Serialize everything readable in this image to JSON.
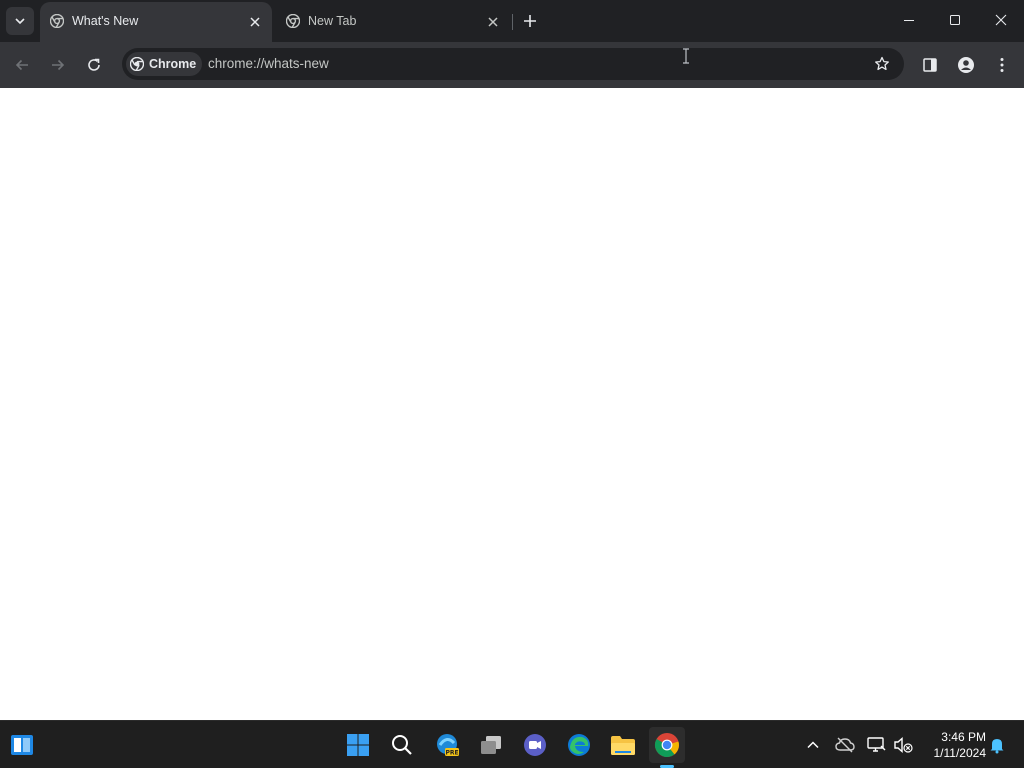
{
  "browser": {
    "tabs": [
      {
        "title": "What's New",
        "active": true
      },
      {
        "title": "New Tab",
        "active": false
      }
    ],
    "toolbar": {
      "chip_label": "Chrome",
      "url": "chrome://whats-new"
    }
  },
  "taskbar": {
    "pinned": [
      "widgets-icon",
      "start-icon",
      "search-icon",
      "edge-beta-icon",
      "task-view-icon",
      "teams-icon",
      "edge-icon",
      "file-explorer-icon",
      "chrome-icon"
    ],
    "active_app": "chrome-icon",
    "clock": {
      "time": "3:46 PM",
      "date": "1/11/2024"
    }
  },
  "colors": {
    "tabstrip": "#202124",
    "toolbar": "#35363a",
    "taskbar": "#1f1f1f",
    "accent": "#4cc2ff"
  }
}
